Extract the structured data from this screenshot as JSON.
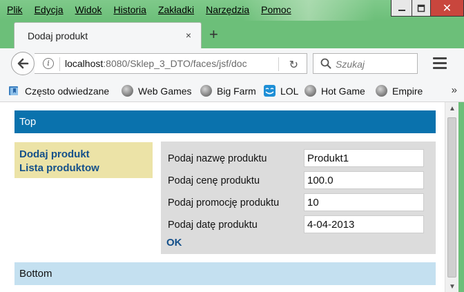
{
  "menu": {
    "items": [
      "Plik",
      "Edycja",
      "Widok",
      "Historia",
      "Zakładki",
      "Narzędzia",
      "Pomoc"
    ]
  },
  "window": {
    "close_glyph": "✕"
  },
  "tab": {
    "title": "Dodaj produkt",
    "close_glyph": "×",
    "new_tab_glyph": "+"
  },
  "navbar": {
    "url_host": "localhost",
    "url_rest": ":8080/Sklep_3_DTO/faces/jsf/doc",
    "info_glyph": "i",
    "reload_glyph": "↻",
    "search_placeholder": "Szukaj"
  },
  "bookmarks": {
    "items": [
      {
        "label": "Często odwiedzane",
        "icon": "bookmarks-icon"
      },
      {
        "label": "Web Games",
        "icon": "globe-icon"
      },
      {
        "label": "Big Farm",
        "icon": "globe-icon"
      },
      {
        "label": "LOL",
        "icon": "lol-icon"
      },
      {
        "label": "Hot Game",
        "icon": "globe-icon"
      },
      {
        "label": "Empire",
        "icon": "globe-icon"
      }
    ],
    "more_glyph": "»"
  },
  "page": {
    "top_label": "Top",
    "bottom_label": "Bottom",
    "nav_links": [
      "Dodaj produkt",
      "Lista produktow"
    ],
    "form": {
      "fields": [
        {
          "label": "Podaj nazwę produktu",
          "value": "Produkt1"
        },
        {
          "label": "Podaj cenę produktu",
          "value": "100.0"
        },
        {
          "label": "Podaj promocję produktu",
          "value": "10"
        },
        {
          "label": "Podaj datę produktu",
          "value": "4-04-2013"
        }
      ],
      "submit_label": "OK"
    }
  },
  "colors": {
    "top_bar": "#0a72ad",
    "bottom_bar": "#c4e0f0",
    "nav_panel": "#ece3a7",
    "form_panel": "#dcdcdc",
    "link": "#14508a",
    "window_frame": "#6cbf79"
  }
}
